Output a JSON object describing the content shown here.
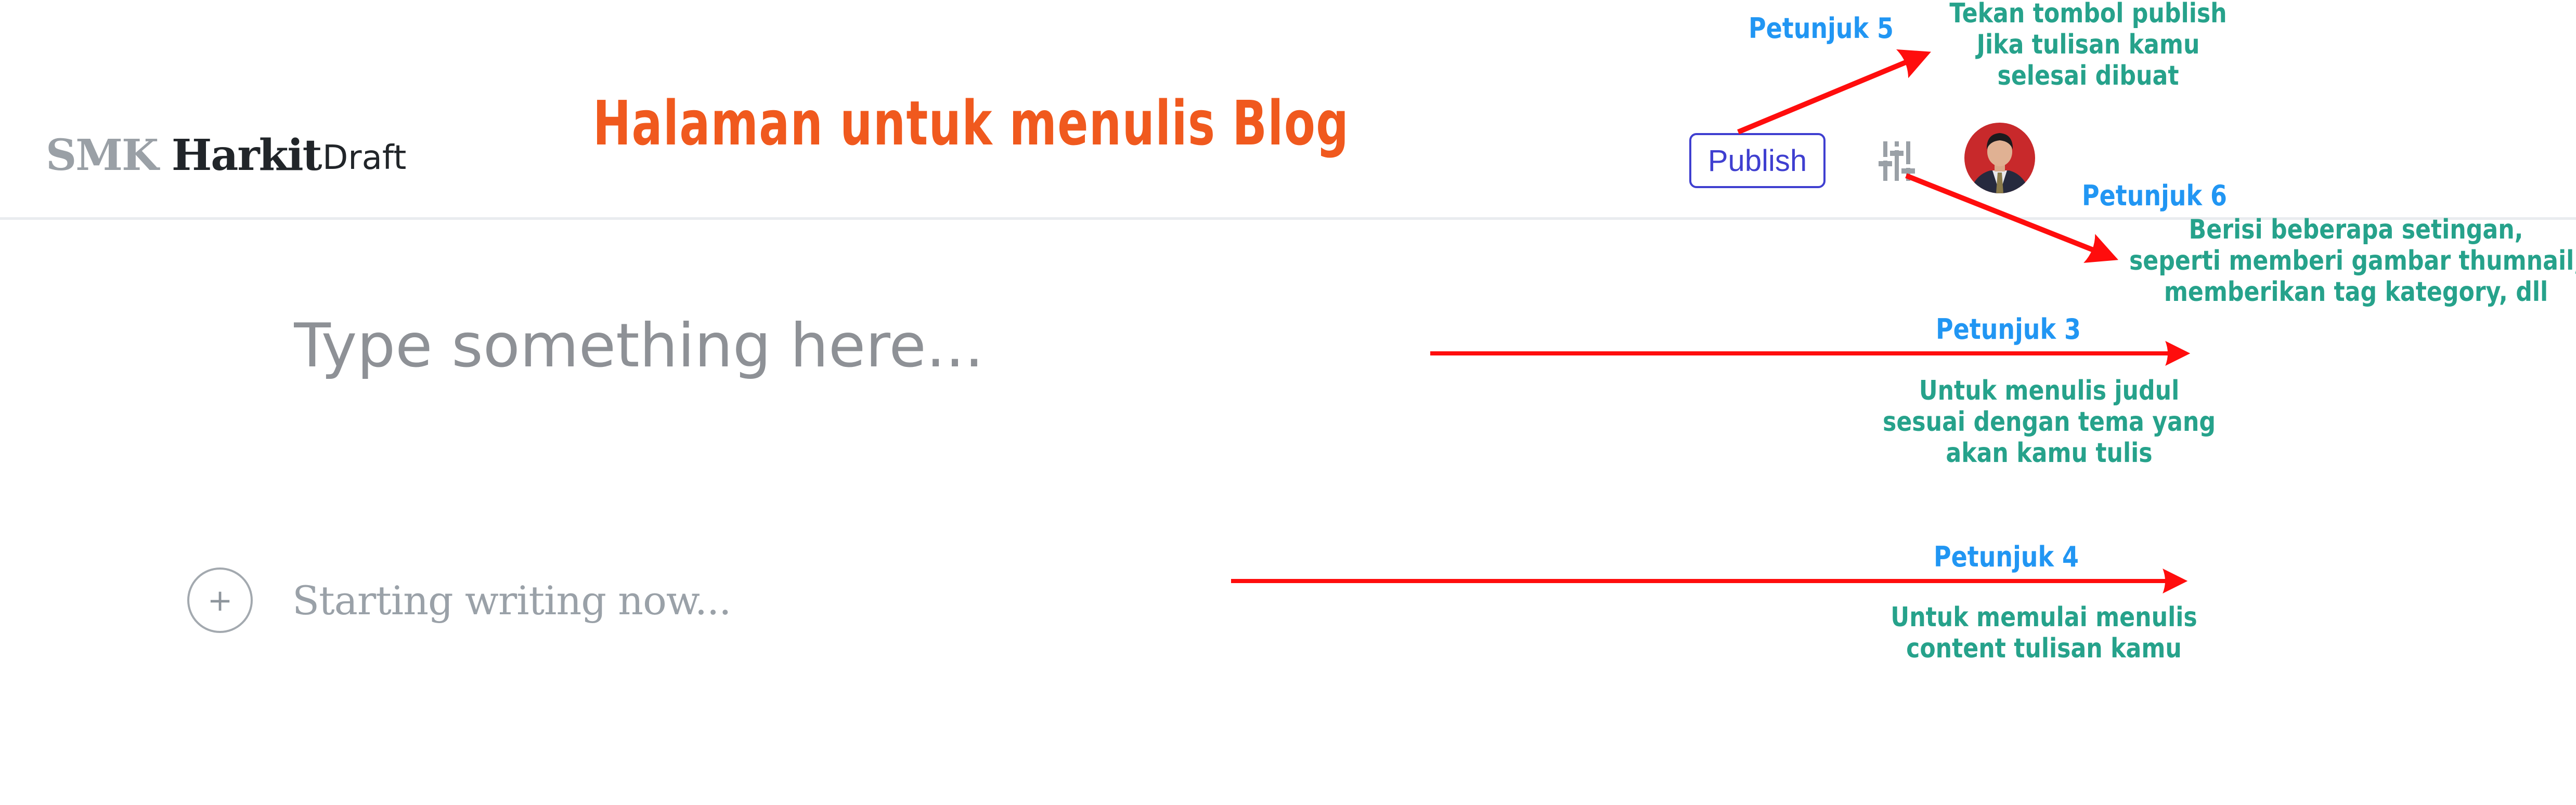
{
  "header": {
    "logo": {
      "part1": "SMK",
      "part2": "Harkit"
    },
    "status": "Draft",
    "publish_label": "Publish",
    "settings_icon": "sliders-icon",
    "avatar_icon": "user-avatar"
  },
  "page_heading": "Halaman untuk menulis Blog",
  "editor": {
    "title_placeholder": "Type something here...",
    "title_value": "",
    "add_block_label": "+",
    "body_placeholder": "Starting writing now...",
    "body_value": ""
  },
  "annotations": [
    {
      "id": 5,
      "label": "Petunjuk 5",
      "lines": [
        "Tekan tombol publish",
        "Jika tulisan kamu",
        "selesai dibuat"
      ]
    },
    {
      "id": 6,
      "label": "Petunjuk 6",
      "lines": [
        "Berisi beberapa setingan,",
        "seperti memberi gambar thumnail,",
        "memberikan tag kategory, dll"
      ]
    },
    {
      "id": 3,
      "label": "Petunjuk 3",
      "lines": [
        "Untuk menulis judul",
        "sesuai dengan tema yang",
        "akan kamu tulis"
      ]
    },
    {
      "id": 4,
      "label": "Petunjuk 4",
      "lines": [
        "Untuk memulai menulis",
        "content tulisan kamu"
      ]
    }
  ],
  "colors": {
    "accent": "#3f3fd0",
    "heading": "#f0591e",
    "hint_label": "#2196f3",
    "hint_text": "#26a28b",
    "arrow": "#ff0d0d",
    "avatar_bg": "#c8292b"
  }
}
